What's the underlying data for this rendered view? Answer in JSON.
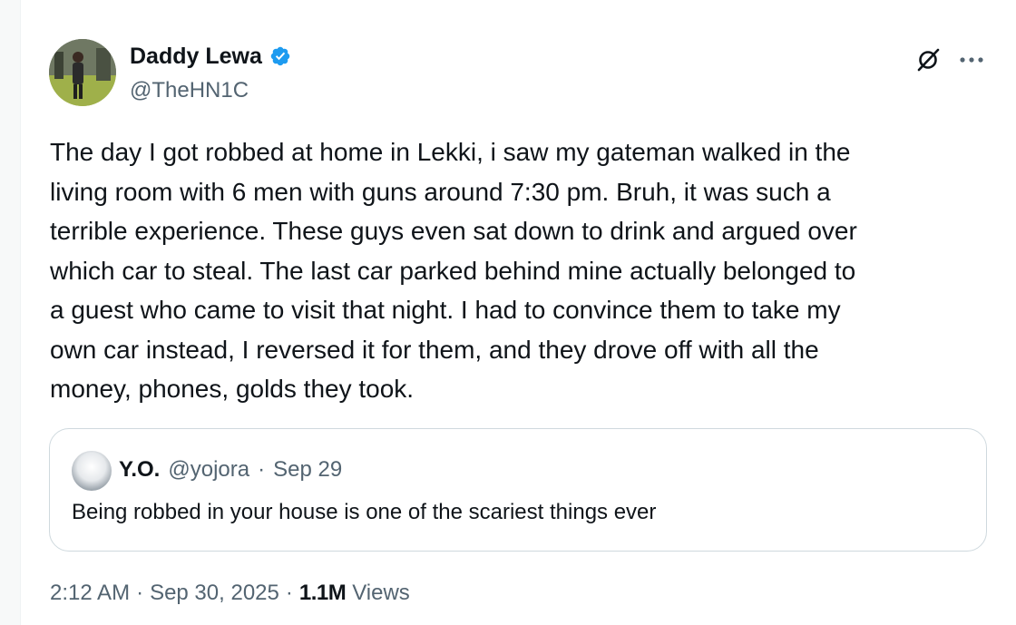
{
  "author": {
    "display_name": "Daddy Lewa",
    "handle": "@TheHN1C",
    "verified": true
  },
  "icons": {
    "verified": "verified-badge-icon",
    "grok": "grok-icon",
    "more": "more-icon"
  },
  "colors": {
    "verified_blue": "#1d9bf0",
    "text_primary": "#0f1419",
    "text_secondary": "#536471",
    "border": "#cfd9de"
  },
  "tweet": {
    "text": "The day I got robbed at home in Lekki, i saw my gateman walked in the\nliving room with 6 men with guns around 7:30 pm. Bruh, it was such a\nterrible experience. These guys even sat down to drink and argued over\nwhich car to steal. The last car parked behind mine actually belonged to\na guest who came to visit that night. I had to convince them to take my\nown car instead, I reversed it for them, and they drove off with all the\nmoney, phones, golds they took."
  },
  "quote": {
    "display_name": "Y.O.",
    "handle": "@yojora",
    "separator": "·",
    "date": "Sep 29",
    "text": "Being robbed in your house is one of the scariest things ever"
  },
  "footer": {
    "time": "2:12 AM",
    "separator": "·",
    "date": "Sep 30, 2025",
    "separator2": "·",
    "views_count": "1.1M",
    "views_label": "Views"
  }
}
